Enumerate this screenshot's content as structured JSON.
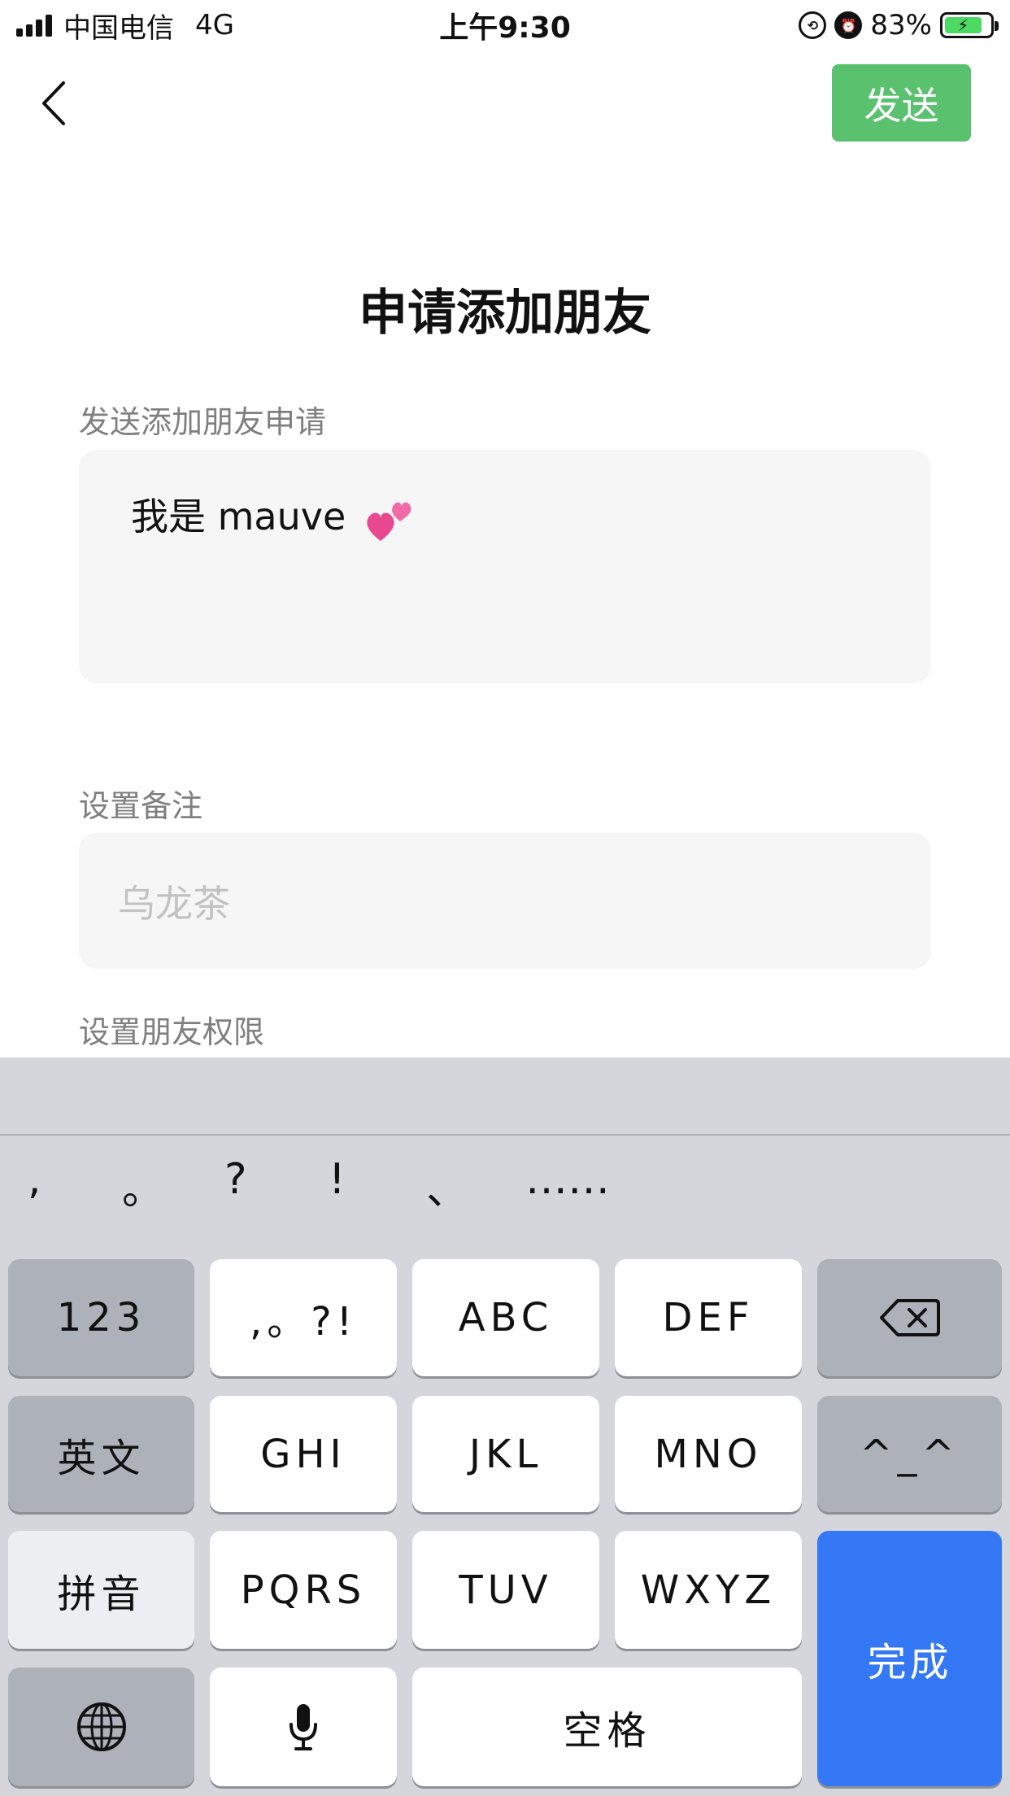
{
  "status_bar": {
    "carrier": "中国电信",
    "network": "4G",
    "time": "上午9:30",
    "battery": "83%"
  },
  "nav": {
    "send_label": "发送"
  },
  "page": {
    "title": "申请添加朋友",
    "request_label": "发送添加朋友申请",
    "request_message": "我是 mauve",
    "remark_label": "设置备注",
    "remark_placeholder": "乌龙茶",
    "permission_label": "设置朋友权限"
  },
  "keyboard": {
    "punctuation": [
      ",",
      "。",
      "?",
      "!",
      "、",
      "……"
    ],
    "keys": {
      "num": "123",
      "punct": ",。?!",
      "abc": "ABC",
      "def": "DEF",
      "english": "英文",
      "ghi": "GHI",
      "jkl": "JKL",
      "mno": "MNO",
      "emoticon": "^_^",
      "pinyin": "拼音",
      "pqrs": "PQRS",
      "tuv": "TUV",
      "wxyz": "WXYZ",
      "done": "完成",
      "space": "空格"
    },
    "accent_color": "#3478f6"
  },
  "colors": {
    "send_button": "#5ac16f",
    "input_background": "#f6f6f6",
    "keyboard_background": "#d4d6db"
  },
  "icons": [
    "signal-icon",
    "orientation-lock-icon",
    "alarm-icon",
    "battery-icon",
    "back-chevron-icon",
    "heart-emoji-icon",
    "backspace-icon",
    "globe-icon",
    "microphone-icon"
  ]
}
